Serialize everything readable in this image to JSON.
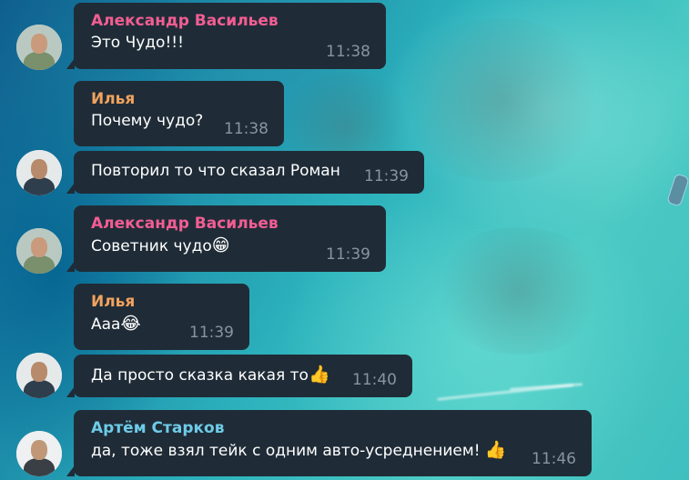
{
  "colors": {
    "bubble_bg": "#1f2c37",
    "time": "#8795a1",
    "alexander": "#f25d93",
    "ilya": "#f2a25d",
    "artem": "#6ecbe8"
  },
  "messages": [
    {
      "author": "Александр Васильев",
      "text": "Это Чудо!!!",
      "time": "11:38",
      "avatar": "avatar-alexander"
    },
    {
      "author": "Илья",
      "text": "Почему чудо?",
      "time": "11:38"
    },
    {
      "text": "Повторил то что сказал Роман",
      "time": "11:39",
      "avatar": "avatar-roman"
    },
    {
      "author": "Александр Васильев",
      "text": "Советник чудо",
      "emoji": "😁",
      "emoji_name": "grinning-face-icon",
      "time": "11:39",
      "avatar": "avatar-alexander"
    },
    {
      "author": "Илья",
      "text": "Ааа",
      "emoji": "😂",
      "emoji_name": "tears-of-joy-icon",
      "time": "11:39"
    },
    {
      "text": "Да просто сказка какая то",
      "emoji": "👍",
      "emoji_name": "thumbs-up-icon",
      "time": "11:40",
      "avatar": "avatar-roman"
    },
    {
      "author": "Артём Старков",
      "text": "да, тоже взял тейк с одним авто-усреднением! ",
      "emoji": "👍",
      "emoji_name": "thumbs-up-icon",
      "time": "11:46",
      "avatar": "avatar-artem"
    }
  ]
}
